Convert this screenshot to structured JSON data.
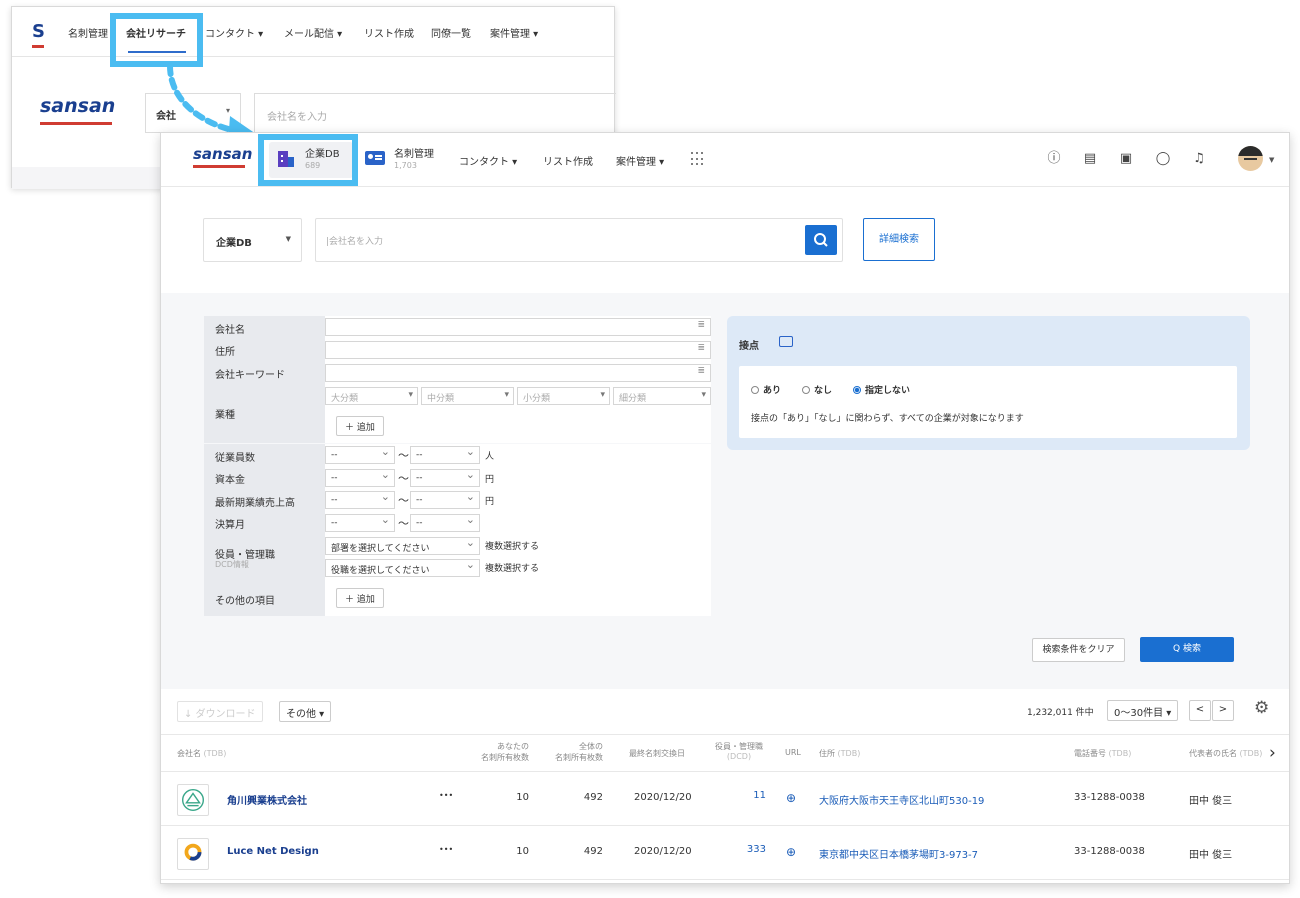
{
  "back_window": {
    "logo": "S",
    "nav": [
      "名刺管理",
      "会社リサーチ",
      "コンタクト ▾",
      "メール配信 ▾",
      "リスト作成",
      "同僚一覧",
      "案件管理 ▾"
    ],
    "brand": "sansan",
    "select_label": "会社",
    "search_placeholder": "会社名を入力"
  },
  "topnav": {
    "brand": "sansan",
    "tab_db": {
      "label": "企業DB",
      "count": "689"
    },
    "tab_cards": {
      "label": "名刺管理",
      "count": "1,703"
    },
    "links": [
      "コンタクト ▾",
      "リスト作成",
      "案件管理 ▾"
    ],
    "icons": [
      "help-icon",
      "list-icon",
      "contact-card-icon",
      "chat-icon",
      "bell-icon"
    ]
  },
  "search": {
    "select_label": "企業DB",
    "placeholder": "|会社名を入力",
    "detail_button": "詳細検索"
  },
  "filters": {
    "company_name": "会社名",
    "address": "住所",
    "keyword": "会社キーワード",
    "industry": "業種",
    "industry_dropdowns": [
      "大分類",
      "中分類",
      "小分類",
      "細分類"
    ],
    "add": "＋ 追加",
    "employees": "従業員数",
    "capital": "資本金",
    "sales": "最新期業績売上高",
    "fiscal_month": "決算月",
    "range_placeholder": "--",
    "tilde": "〜",
    "unit_people": "人",
    "unit_yen": "円",
    "executives": "役員・管理職",
    "executives_sub": "DCD情報",
    "dept_placeholder": "部署を選択してください",
    "title_placeholder": "役職を選択してください",
    "multi_select": "複数選択する",
    "other_items": "その他の項目"
  },
  "contact": {
    "title": "接点",
    "options": [
      "あり",
      "なし",
      "指定しない"
    ],
    "selected": "指定しない",
    "note": "接点の「あり」「なし」に関わらず、すべての企業が対象になります"
  },
  "actions": {
    "clear": "検索条件をクリア",
    "search": "Q 検索"
  },
  "results_toolbar": {
    "download": "↓ ダウンロード",
    "other": "その他 ▾",
    "count": "1,232,011 件中",
    "range": "0〜30件目 ▾",
    "prev": "<",
    "next": ">"
  },
  "table": {
    "headers": {
      "company": "会社名",
      "company_src": "(TDB)",
      "your_cards_1": "あなたの",
      "your_cards_2": "名刺所有枚数",
      "all_cards_1": "全体の",
      "all_cards_2": "名刺所有枚数",
      "last_exchange": "最終名刺交換日",
      "exec_1": "役員・管理職",
      "exec_2": "(DCD)",
      "url": "URL",
      "address": "住所",
      "address_src": "(TDB)",
      "phone": "電話番号",
      "phone_src": "(TDB)",
      "rep": "代表者の氏名",
      "rep_src": "(TDB)"
    },
    "rows": [
      {
        "name": "角川興業株式会社",
        "more": "•••",
        "your": "10",
        "all": "492",
        "date": "2020/12/20",
        "exec": "11",
        "address": "大阪府大阪市天王寺区北山町530-19",
        "phone": "33-1288-0038",
        "rep": "田中 俊三"
      },
      {
        "name": "Luce Net Design",
        "more": "•••",
        "your": "10",
        "all": "492",
        "date": "2020/12/20",
        "exec": "333",
        "address": "東京都中央区日本橋茅場町3-973-7",
        "phone": "33-1288-0038",
        "rep": "田中 俊三"
      }
    ]
  },
  "colors": {
    "accent": "#1a6fd1",
    "highlight": "#4bbcf1",
    "brand": "#1a3f8f",
    "brand_red": "#d03c32"
  }
}
